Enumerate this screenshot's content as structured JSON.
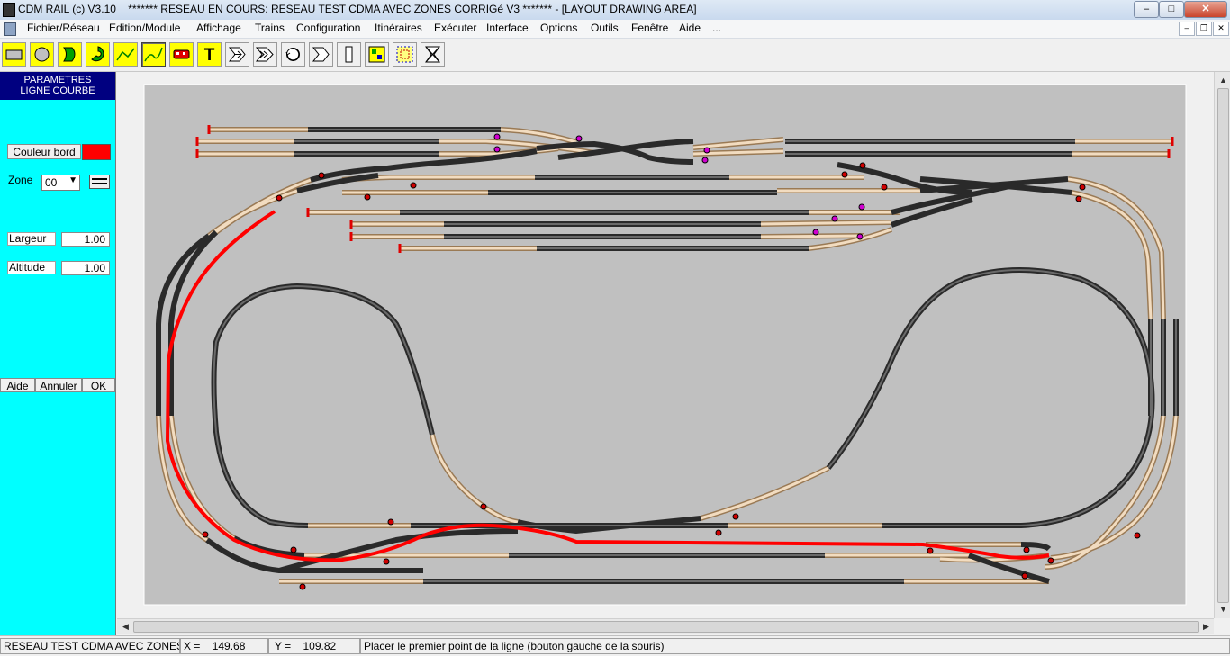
{
  "window": {
    "app_title": "CDM RAIL (c) V3.10",
    "network_title": "******* RESEAU EN COURS: RESEAU TEST CDMA AVEC ZONES CORRIGé V3 ******* - [LAYOUT DRAWING AREA]",
    "minimize": "–",
    "maximize": "□",
    "close": "✕"
  },
  "menu": {
    "items": [
      "Fichier/Réseau",
      "Edition/Module",
      "Affichage",
      "Trains",
      "Configuration",
      "Itinéraires",
      "Exécuter",
      "Interface",
      "Options",
      "Outils",
      "Fenêtre",
      "Aide",
      "..."
    ]
  },
  "toolbar": {
    "tools": [
      {
        "icon": "rectangle-tool-icon"
      },
      {
        "icon": "circle-tool-icon"
      },
      {
        "icon": "curve-right-tool-icon"
      },
      {
        "icon": "curve-left-tool-icon"
      },
      {
        "icon": "straight-line-tool-icon"
      },
      {
        "icon": "curved-line-tool-icon",
        "active": true
      },
      {
        "icon": "train-tool-icon"
      },
      {
        "icon": "text-tool-icon",
        "glyph": "T"
      },
      {
        "icon": "turnout-tool-icon"
      },
      {
        "icon": "double-turnout-tool-icon"
      },
      {
        "icon": "turntable-tool-icon"
      },
      {
        "icon": "arrow-tool-icon"
      },
      {
        "icon": "bar-tool-icon"
      },
      {
        "icon": "signal-tool-icon"
      },
      {
        "icon": "grid-tool-icon"
      },
      {
        "icon": "crossing-tool-icon"
      }
    ]
  },
  "panel": {
    "title_line1": "PARAMETRES",
    "title_line2": "LIGNE COURBE",
    "border_color_button": "Couleur bord",
    "border_color": "#ff0000",
    "zone_label": "Zone",
    "zone_value": "00",
    "width_label": "Largeur",
    "width_value": "1.00",
    "altitude_label": "Altitude",
    "altitude_value": "1.00",
    "help_button": "Aide",
    "cancel_button": "Annuler",
    "ok_button": "OK",
    "background_color": "#00ffff",
    "header_color": "#000080"
  },
  "canvas": {
    "background": "#c0c0c0",
    "track_color": "#3a3a3a",
    "zone_track_color": "#c8a070",
    "drawn_line_color": "#ff0000"
  },
  "status": {
    "network_name": "RESEAU TEST CDMA AVEC ZONES CC",
    "x_label": "X =",
    "x_value": "149.68",
    "y_label": "Y =",
    "y_value": "109.82",
    "hint": "Placer le premier point de la ligne (bouton gauche de la souris)"
  }
}
